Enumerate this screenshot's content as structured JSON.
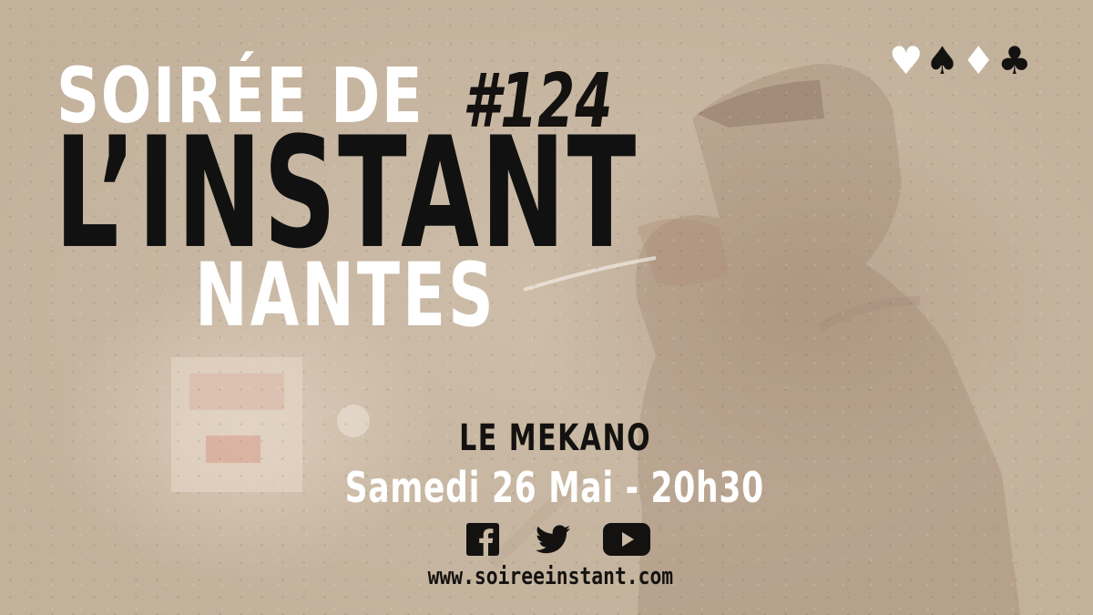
{
  "title": {
    "line1": "SOIRÉE DE",
    "number": "#124",
    "line2": "L’INSTANT",
    "city": "NANTES"
  },
  "suits": [
    "♥",
    "♠",
    "♦",
    "♣"
  ],
  "event": {
    "venue": "LE MEKANO",
    "date": "Samedi 26 Mai - 20h30"
  },
  "social": {
    "icons": [
      "facebook-icon",
      "twitter-icon",
      "youtube-icon"
    ],
    "website": "www.soireeinstant.com"
  },
  "colors": {
    "background": "#c9b8a4",
    "dark_text": "#141210",
    "light_text": "#ffffff"
  }
}
